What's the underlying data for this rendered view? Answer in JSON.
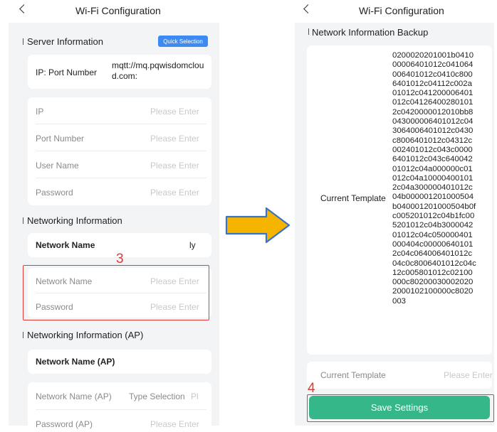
{
  "left_screen": {
    "title": "Wi-Fi Configuration",
    "server_section": {
      "title": "Server Information",
      "quick_selection_label": "Quick Selection",
      "ip_port_label": "IP: Port Number",
      "ip_port_value": "mqtt://mq.pqwisdomcloud.com:",
      "fields": [
        {
          "label": "IP",
          "placeholder": "Please Enter"
        },
        {
          "label": "Port Number",
          "placeholder": "Please Enter"
        },
        {
          "label": "User Name",
          "placeholder": "Please Enter"
        },
        {
          "label": "Password",
          "placeholder": "Please Enter"
        }
      ]
    },
    "networking_section": {
      "title": "Networking Information",
      "network_name_label": "Network Name",
      "network_name_value": "ly",
      "fields": [
        {
          "label": "Network Name",
          "placeholder": "Please Enter"
        },
        {
          "label": "Password",
          "placeholder": "Please Enter"
        }
      ]
    },
    "ap_section": {
      "title": "Networking Information (AP)",
      "network_name_label": "Network Name (AP)",
      "fields": [
        {
          "label": "Network Name (AP)",
          "placeholder": "Type Selection",
          "extra": "Pl"
        },
        {
          "label": "Password (AP)",
          "placeholder": "Please Enter"
        }
      ]
    }
  },
  "right_screen": {
    "title": "Wi-Fi Configuration",
    "backup_section": {
      "title": "Network Information Backup",
      "current_template_label": "Current Template",
      "template_value": "0200020201001b041000006401012c041064006401012c0410c8006401012c04112c002a01012c041200006401012c041264002801012c0420000012010bb8043000006401012c043064006401012c0430c8006401012c04312c002401012c043c00006401012c043c64004201012c04a000000c01012c04a100004001012c04a300000401012c04b000001201000504b040001201000504b0fc005201012c04b1fc005201012c04b300004201012c04c050000401000404c000006401012c04c064006401012c04c0c8006401012c04c12c005801012c02100000c802000300020202000102100000c8020003"
    },
    "current_template_field": {
      "label": "Current Template",
      "placeholder": "Please Enter"
    },
    "save_button_label": "Save Settings"
  },
  "annotations": {
    "step_3": "3",
    "step_4": "4",
    "highlight_color": "#e53935",
    "arrow_color": "#f5b400"
  },
  "colors": {
    "accent_blue": "#3d8bf2",
    "save_green": "#36b789",
    "screen_bg": "#f3f4f6"
  }
}
